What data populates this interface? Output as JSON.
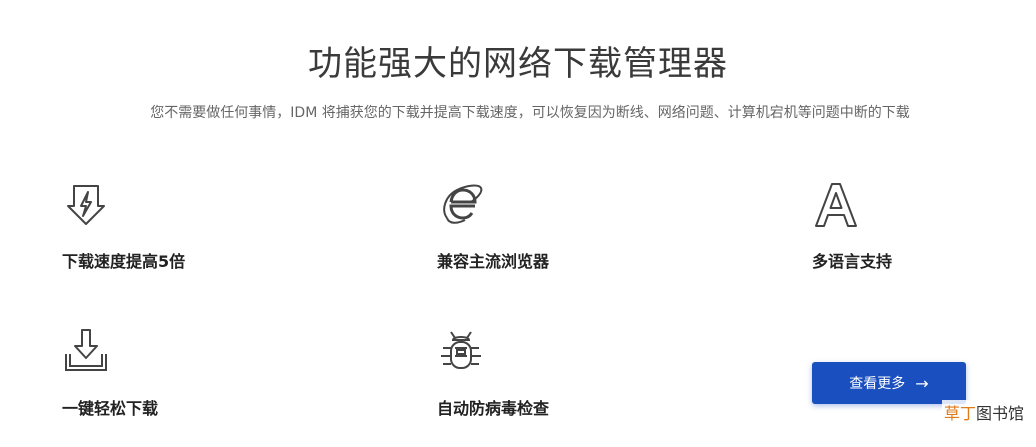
{
  "title": "功能强大的网络下载管理器",
  "subtitle": "您不需要做任何事情，IDM 将捕获您的下载并提高下载速度，可以恢复因为断线、网络问题、计算机宕机等问题中断的下载",
  "features": [
    {
      "label": "下载速度提高5倍",
      "icon": "lightning-download-icon"
    },
    {
      "label": "兼容主流浏览器",
      "icon": "browser-e-icon"
    },
    {
      "label": "多语言支持",
      "icon": "letter-a-icon"
    },
    {
      "label": "一键轻松下载",
      "icon": "tray-download-icon"
    },
    {
      "label": "自动防病毒检查",
      "icon": "bug-icon"
    }
  ],
  "more_button": {
    "label": "查看更多",
    "arrow": "→"
  },
  "watermark": {
    "accent": "草丁",
    "rest": "图书馆"
  },
  "colors": {
    "button": "#1a4fbf",
    "watermark_accent": "#e07b1a"
  }
}
